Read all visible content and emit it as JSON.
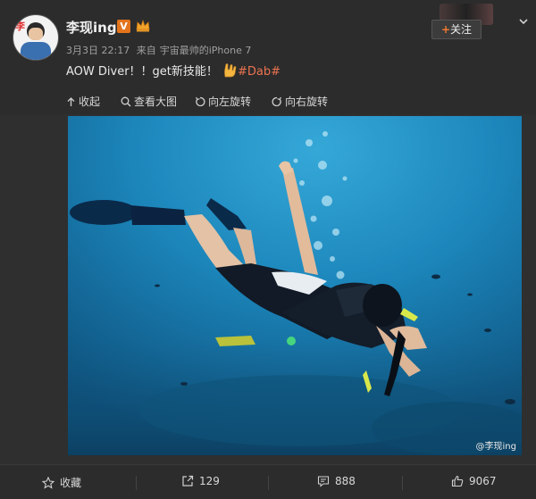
{
  "post": {
    "author": "李现ing",
    "verified_badge": "V",
    "date": "3月3日 22:17",
    "source_prefix": "来自",
    "source": "宇宙最帅的iPhone 7",
    "text": "AOW Diver！！get新技能！",
    "hashtag": "#Dab#",
    "follow_label": "关注"
  },
  "toolbar": {
    "collapse": "收起",
    "view_large": "查看大图",
    "rotate_left": "向左旋转",
    "rotate_right": "向右旋转"
  },
  "photo": {
    "watermark": "@李现ing"
  },
  "footer": {
    "favorite": "收藏",
    "reposts": "129",
    "comments": "888",
    "likes": "9067"
  },
  "colors": {
    "accent": "#eb7350",
    "background": "#2c2c2c",
    "water": "#1b7fb3"
  }
}
